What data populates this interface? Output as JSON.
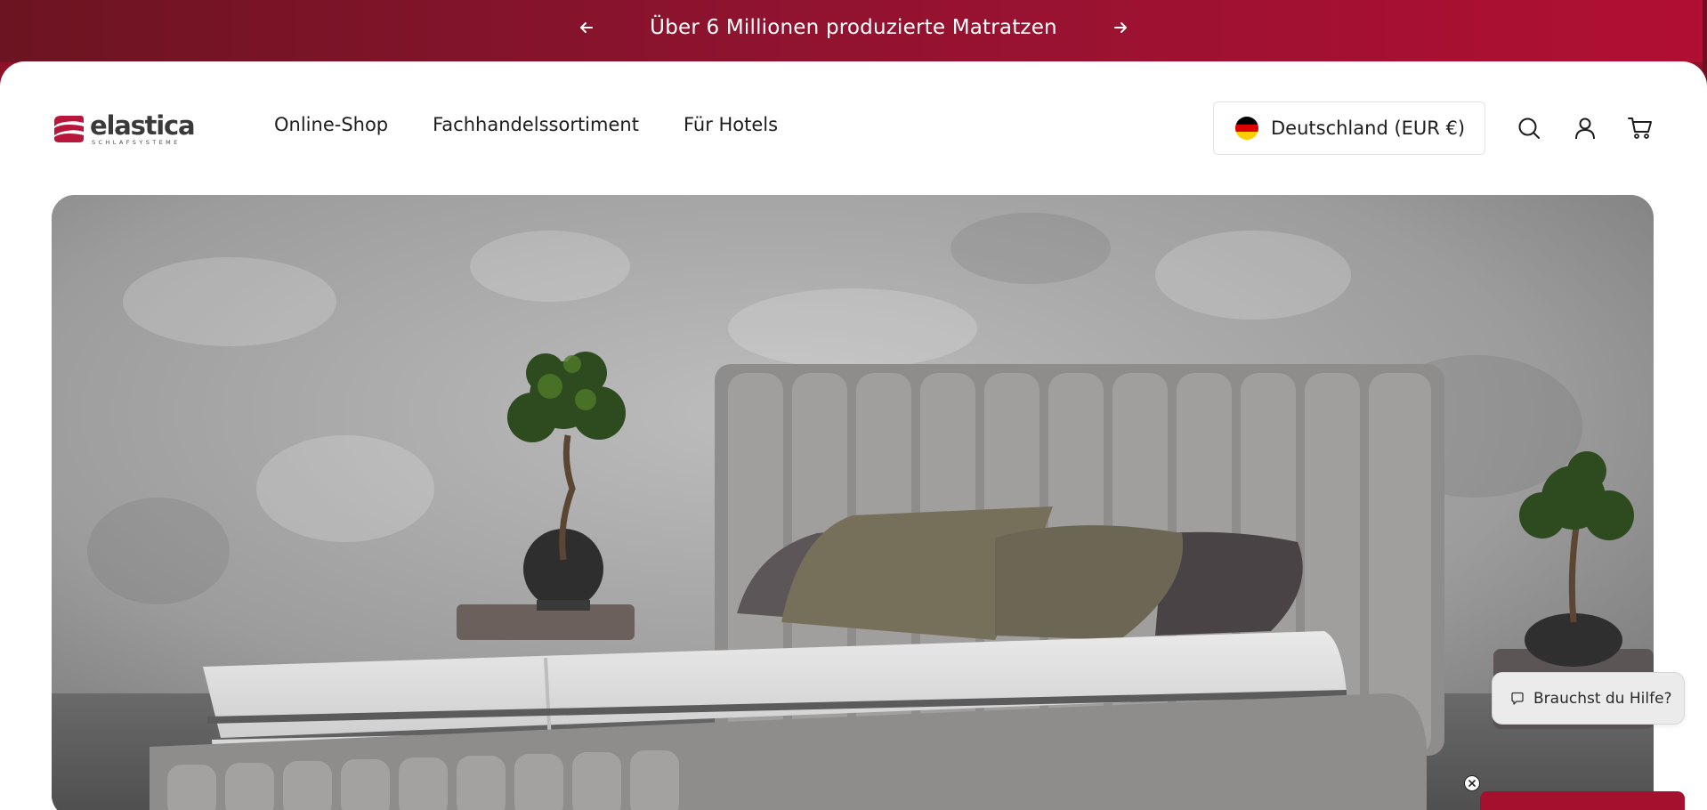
{
  "announcement": {
    "text": "Über 6 Millionen produzierte Matratzen",
    "prev_icon": "arrow-left-icon",
    "next_icon": "arrow-right-icon"
  },
  "brand": {
    "name": "elastica",
    "tagline": "SCHLAFSYSTEME"
  },
  "nav": {
    "items": [
      {
        "label": "Online-Shop"
      },
      {
        "label": "Fachhandelssortiment"
      },
      {
        "label": "Für Hotels"
      }
    ]
  },
  "country_selector": {
    "label": "Deutschland (EUR €)",
    "flag_icon": "germany-flag-icon"
  },
  "header_icons": [
    "search-icon",
    "account-icon",
    "cart-icon"
  ],
  "help_widget": {
    "label": "Brauchst du Hilfe?",
    "icon": "chat-bubble-icon"
  },
  "colors": {
    "brand_red": "#a5102e",
    "announcement_start": "#6c1421",
    "announcement_end": "#b10f33",
    "text": "#1d1d1d"
  }
}
